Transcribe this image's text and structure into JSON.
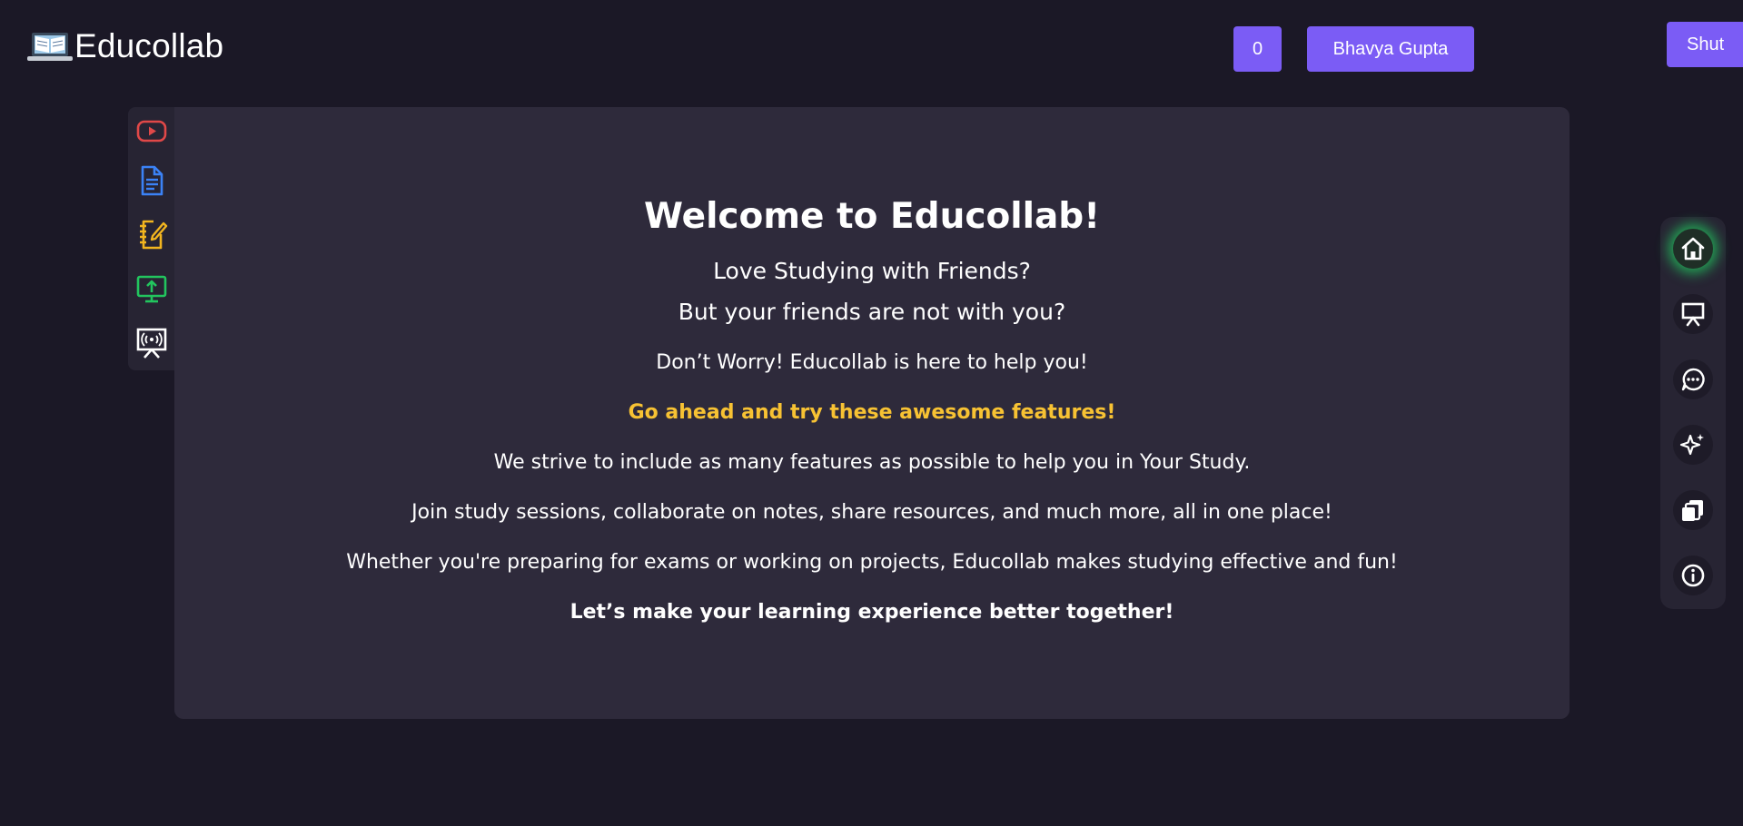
{
  "header": {
    "app_name": "Educollab",
    "logo_icon": "open-book-laptop-icon",
    "count": "0",
    "user_name": "Bhavya Gupta",
    "shut_label": "Shut"
  },
  "colors": {
    "background": "#1b1826",
    "card": "#2e2a3b",
    "rail": "#272433",
    "accent": "#7b5cf5",
    "highlight": "#f7c233",
    "active_glow": "#22c55e"
  },
  "left_rail": {
    "items": [
      {
        "icon": "youtube-icon",
        "color": "#e04848"
      },
      {
        "icon": "document-icon",
        "color": "#3b82f6"
      },
      {
        "icon": "notebook-edit-icon",
        "color": "#f2b51f"
      },
      {
        "icon": "screen-share-icon",
        "color": "#22c55e"
      },
      {
        "icon": "live-presentation-icon",
        "color": "#ffffff"
      }
    ]
  },
  "main": {
    "welcome": "Welcome to Educollab!",
    "line1": "Love Studying with Friends?",
    "line2": "But your friends are not with you?",
    "line3": "Don’t Worry! Educollab is here to help you!",
    "line4": "Go ahead and try these awesome features!",
    "line5": "We strive to include as many features as possible to help you in Your Study.",
    "line6": "Join study sessions, collaborate on notes, share resources, and much more, all in one place!",
    "line7": "Whether you're preparing for exams or working on projects, Educollab makes studying effective and fun!",
    "line8": "Let’s make your learning experience better together!"
  },
  "right_rail": {
    "items": [
      {
        "icon": "home-icon",
        "active": true
      },
      {
        "icon": "presentation-board-icon",
        "active": false
      },
      {
        "icon": "chat-bubble-icon",
        "active": false
      },
      {
        "icon": "sparkles-icon",
        "active": false
      },
      {
        "icon": "copy-documents-icon",
        "active": false
      },
      {
        "icon": "info-icon",
        "active": false
      }
    ]
  }
}
